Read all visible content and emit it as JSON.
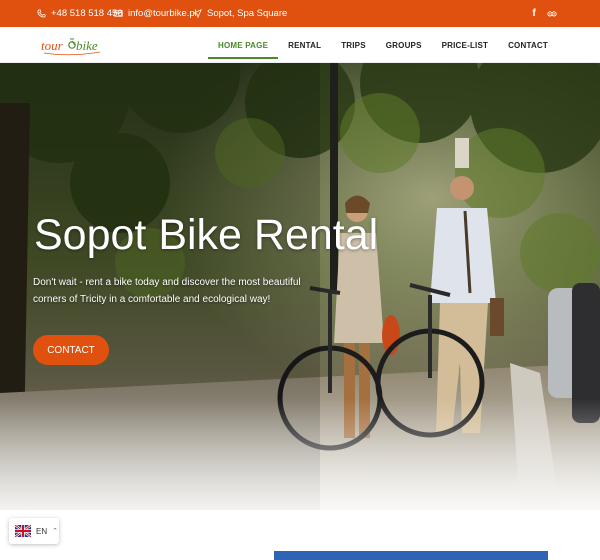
{
  "topbar": {
    "phone": "+48 518 518 456",
    "email": "info@tourbike.pl",
    "location": "Sopot, Spa Square",
    "social": [
      "facebook-icon",
      "tripadvisor-icon"
    ]
  },
  "nav": {
    "logo_text": "tour bike",
    "items": [
      "HOME PAGE",
      "RENTAL",
      "TRIPS",
      "GROUPS",
      "PRICE-LIST",
      "CONTACT"
    ],
    "active_index": 0
  },
  "hero": {
    "title": "Sopot Bike Rental",
    "text": "Don't wait - rent a bike today and discover the most beautiful corners of Tricity in a comfortable and ecological way!",
    "cta": "CONTACT"
  },
  "lang": {
    "code": "EN"
  },
  "colors": {
    "accent": "#e0510f",
    "nav_active": "#4a8a2a",
    "strip": "#2f63b5"
  }
}
